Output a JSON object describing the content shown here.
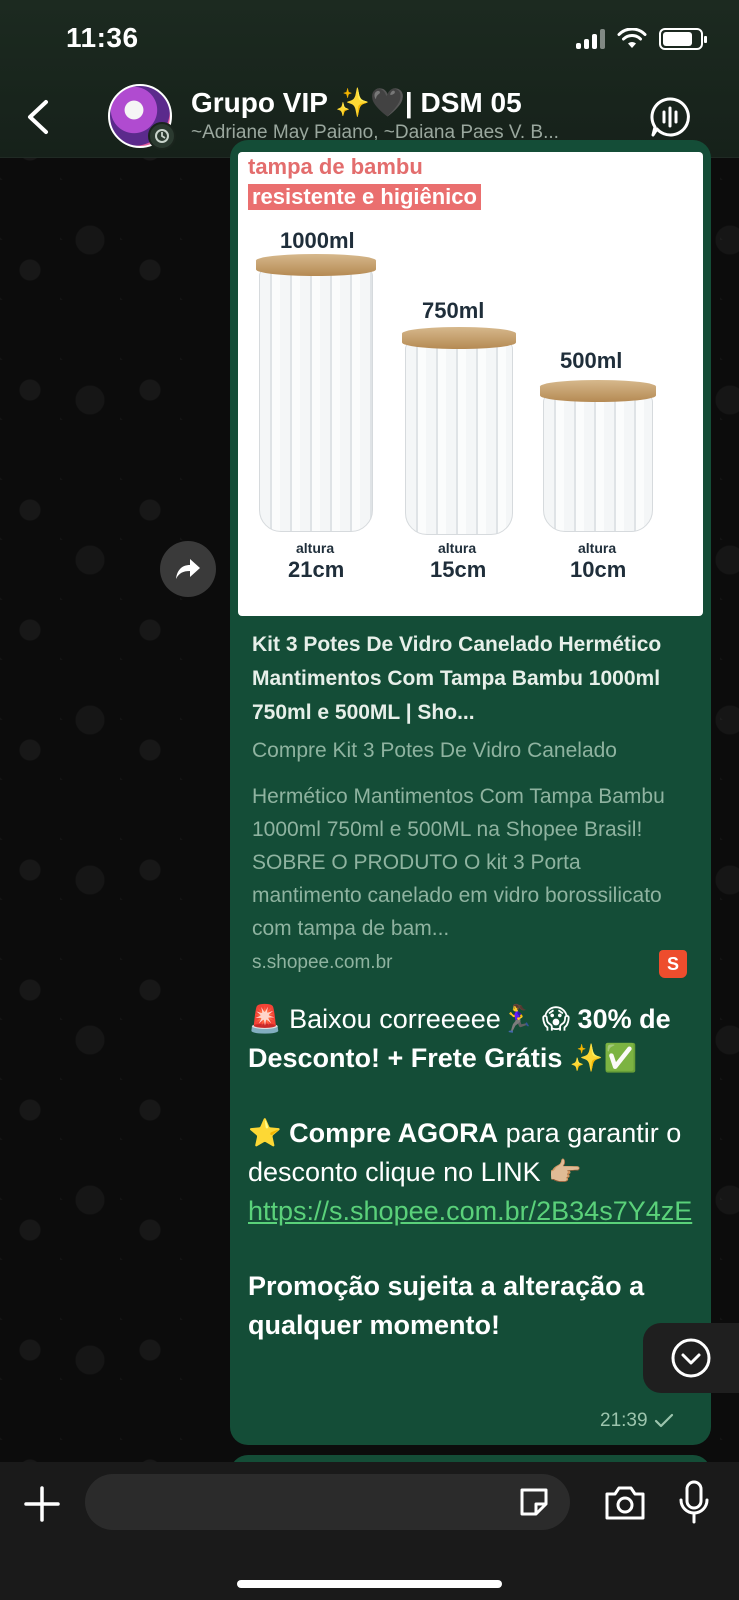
{
  "status_bar": {
    "time": "11:36"
  },
  "header": {
    "title": "Grupo VIP ✨🖤|  DSM 05",
    "subtitle": "~Adriane May Paiano, ~Daiana Paes V. B..."
  },
  "message": {
    "preview_image": {
      "tag_line_1": "tampa de bambu",
      "tag_line_2": "resistente e higiênico",
      "jars": [
        {
          "size": "1000ml",
          "height_label": "altura",
          "height": "21cm"
        },
        {
          "size": "750ml",
          "height_label": "altura",
          "height": "15cm"
        },
        {
          "size": "500ml",
          "height_label": "altura",
          "height": "10cm"
        }
      ]
    },
    "link_preview": {
      "title": "Kit 3 Potes De Vidro Canelado Hermético Mantimentos Com Tampa Bambu 1000ml 750ml e 500ML | Sho...",
      "desc_line_1": "Compre Kit 3 Potes De Vidro Canelado",
      "desc_line_2": "Hermético Mantimentos Com Tampa Bambu 1000ml 750ml e 500ML na Shopee Brasil! SOBRE O PRODUTO O kit 3 Porta mantimento canelado em vidro borossilicato com tampa de bam...",
      "domain": "s.shopee.com.br",
      "site_icon": "shopee-bag-icon"
    },
    "text": {
      "line1_emoji": "🚨",
      "line1_plain": "Baixou correeeee🏃‍♀️ 😱 ",
      "line1_bold": "30% de Desconto! + Frete Grátis",
      "line1_end_emoji": "✨✅",
      "line2_emoji": "⭐",
      "line2_bold": "Compre AGORA",
      "line2_plain": " para garantir o desconto clique no LINK 👉🏼 ",
      "link": "https://s.shopee.com.br/2B34s7Y4zE",
      "line3_bold": "Promoção sujeita a alteração a qualquer momento!"
    },
    "time": "21:39",
    "status_icon": "check-icon"
  },
  "input": {
    "placeholder": ""
  },
  "colors": {
    "bubble": "#144d37",
    "link": "#5ad17a",
    "header_bg": "#1c2a20",
    "shopee": "#ee4d2d"
  }
}
